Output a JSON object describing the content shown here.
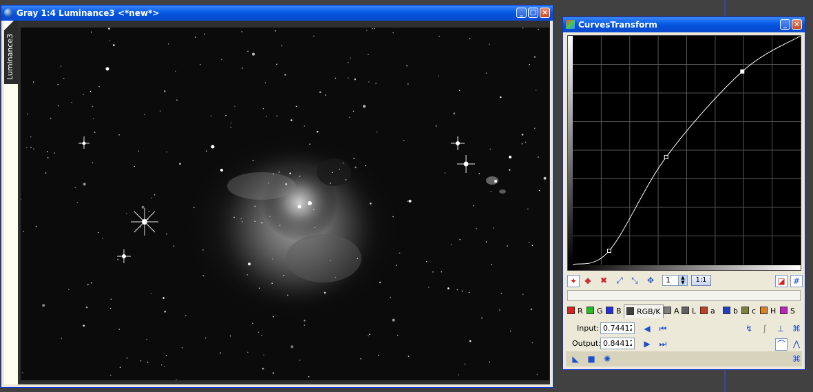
{
  "image_window": {
    "title": "Gray 1:4 Luminance3 <*new*>",
    "tab_label": "Luminance3",
    "controls": {
      "minimize": "_",
      "maximize": "□",
      "close": "×"
    }
  },
  "curves_window": {
    "title": "CurvesTransform",
    "controls": {
      "minimize": "_",
      "close": "×"
    },
    "toolbar": {
      "zoom_value": "1",
      "zoom_ratio": "1:1"
    },
    "channels": [
      {
        "label": "R",
        "color": "#e02020"
      },
      {
        "label": "G",
        "color": "#20c020"
      },
      {
        "label": "B",
        "color": "#2030e0"
      },
      {
        "label": "RGB/K",
        "color": "#404040",
        "selected": true
      },
      {
        "label": "A",
        "color": "#808080"
      },
      {
        "label": "L",
        "color": "#606060"
      },
      {
        "label": "a",
        "color": "#c04020"
      },
      {
        "label": "b",
        "color": "#2040c0"
      },
      {
        "label": "c",
        "color": "#808040"
      },
      {
        "label": "H",
        "color": "#e08020"
      },
      {
        "label": "S",
        "color": "#c020c0"
      }
    ],
    "input_label": "Input:",
    "input_value": "0.74412",
    "output_label": "Output:",
    "output_value": "0.84412",
    "curve_points": [
      [
        0,
        0
      ],
      [
        0.16,
        0.06
      ],
      [
        0.41,
        0.47
      ],
      [
        0.74412,
        0.84412
      ],
      [
        1,
        1
      ]
    ]
  }
}
